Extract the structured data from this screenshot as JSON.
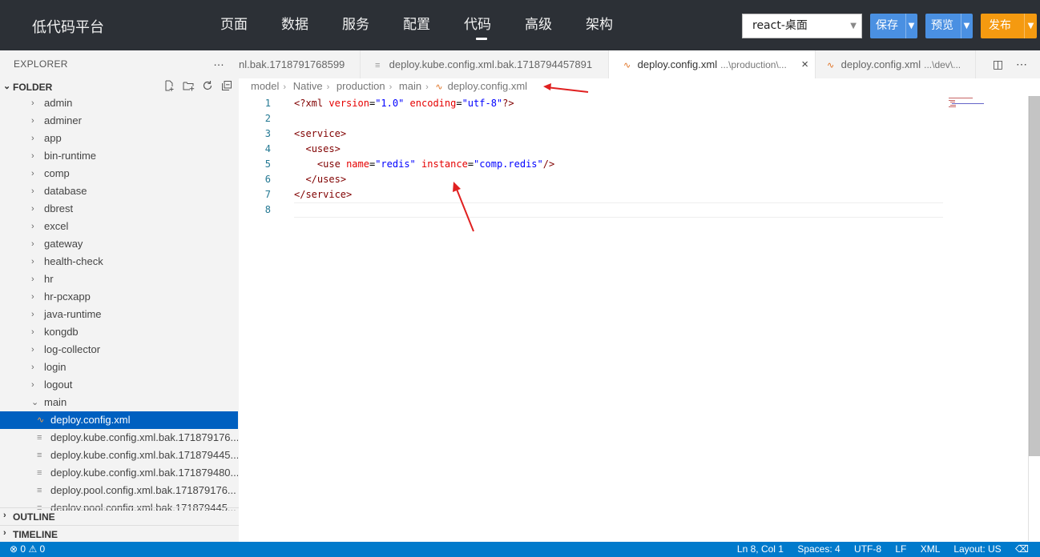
{
  "topbar": {
    "brand": "低代码平台",
    "nav": [
      "页面",
      "数据",
      "服务",
      "配置",
      "代码",
      "高级",
      "架构"
    ],
    "active_nav_index": 4,
    "env_select": "react-桌面",
    "save_label": "保存",
    "preview_label": "预览",
    "publish_label": "发布"
  },
  "sidebar": {
    "explorer_label": "EXPLORER",
    "more_icon": "…",
    "folder_label": "FOLDER",
    "folders": [
      "admin",
      "adminer",
      "app",
      "bin-runtime",
      "comp",
      "database",
      "dbrest",
      "excel",
      "gateway",
      "health-check",
      "hr",
      "hr-pcxapp",
      "java-runtime",
      "kongdb",
      "log-collector",
      "login",
      "logout"
    ],
    "open_folder": "main",
    "files": [
      "deploy.config.xml",
      "deploy.kube.config.xml.bak.171879176...",
      "deploy.kube.config.xml.bak.171879445...",
      "deploy.kube.config.xml.bak.171879480...",
      "deploy.pool.config.xml.bak.171879176...",
      "deploy.pool.config.xml.bak.171879445..."
    ],
    "selected_file_index": 0,
    "outline_label": "OUTLINE",
    "timeline_label": "TIMELINE"
  },
  "tabs": [
    {
      "label": "nl.bak.1718791768599",
      "desc": ""
    },
    {
      "label": "deploy.kube.config.xml.bak.1718794457891",
      "desc": ""
    },
    {
      "label": "deploy.config.xml",
      "desc": "...\\production\\..."
    },
    {
      "label": "deploy.config.xml",
      "desc": "...\\dev\\..."
    }
  ],
  "breadcrumb": [
    "model",
    "Native",
    "production",
    "main",
    "deploy.config.xml"
  ],
  "editor": {
    "line_numbers": [
      "1",
      "2",
      "3",
      "4",
      "5",
      "6",
      "7",
      "8"
    ]
  },
  "status": {
    "errors": "0",
    "warnings": "0",
    "position": "Ln 8, Col 1",
    "spaces": "Spaces: 4",
    "encoding": "UTF-8",
    "eol": "LF",
    "language": "XML",
    "layout": "Layout: US"
  },
  "colors": {
    "topbar_bg": "#2c3036",
    "accent_blue": "#4a90e2",
    "accent_orange": "#f59a10",
    "status_bg": "#007acc",
    "selection_bg": "#0060c0",
    "annotation_red": "#e02020"
  }
}
